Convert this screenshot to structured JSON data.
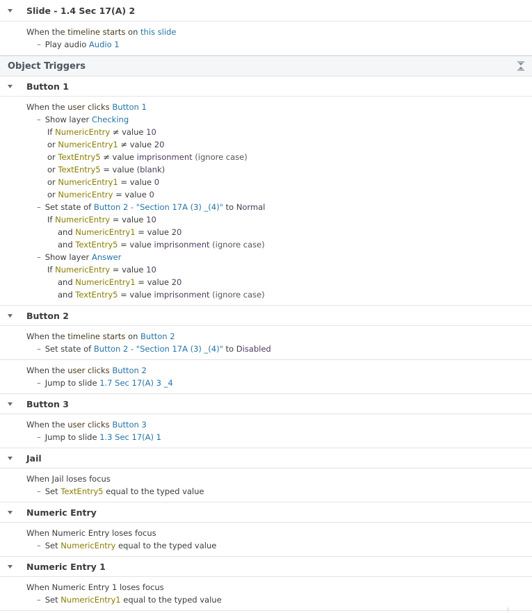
{
  "slide": {
    "title": "Slide - 1.4 Sec 17(A) 2",
    "when": [
      "When the ",
      "timeline starts",
      " on ",
      "this slide"
    ],
    "action": [
      "Play audio ",
      "Audio 1"
    ]
  },
  "object_triggers": {
    "title": "Object Triggers",
    "collapse_icon": "collapse-all-icon"
  },
  "button1": {
    "title": "Button 1",
    "when": [
      "When the ",
      "user clicks",
      " ",
      "Button 1"
    ],
    "show_checking": [
      "Show layer ",
      "Checking"
    ],
    "conds_checking": [
      {
        "pre": "If ",
        "var": "NumericEntry",
        "op": " ≠ value ",
        "val": "10",
        "tail": ""
      },
      {
        "pre": "or ",
        "var": "NumericEntry1",
        "op": " ≠ value ",
        "val": "20",
        "tail": ""
      },
      {
        "pre": "or ",
        "var": "TextEntry5",
        "op": " ≠ value ",
        "val": "imprisonment",
        "tail": " (ignore case)"
      },
      {
        "pre": "or ",
        "var": "TextEntry5",
        "op": " = value ",
        "val": "(blank)",
        "tail": ""
      },
      {
        "pre": "or ",
        "var": "NumericEntry1",
        "op": " = value ",
        "val": "0",
        "tail": ""
      },
      {
        "pre": "or ",
        "var": "NumericEntry",
        "op": " = value ",
        "val": "0",
        "tail": ""
      }
    ],
    "set_state": [
      "Set state of ",
      "Button 2 - \"Section 17A (3) _(4)\"",
      " to ",
      "Normal"
    ],
    "conds_state": [
      {
        "pre": "If ",
        "var": "NumericEntry",
        "op": " = value ",
        "val": "10",
        "tail": ""
      },
      {
        "pre": "and ",
        "var": "NumericEntry1",
        "op": " = value ",
        "val": "20",
        "tail": ""
      },
      {
        "pre": "and ",
        "var": "TextEntry5",
        "op": " = value ",
        "val": "imprisonment",
        "tail": " (ignore case)"
      }
    ],
    "show_answer": [
      "Show layer ",
      "Answer"
    ],
    "conds_answer": [
      {
        "pre": "If ",
        "var": "NumericEntry",
        "op": " = value ",
        "val": "10",
        "tail": ""
      },
      {
        "pre": "and ",
        "var": "NumericEntry1",
        "op": " = value ",
        "val": "20",
        "tail": ""
      },
      {
        "pre": "and ",
        "var": "TextEntry5",
        "op": " = value ",
        "val": "imprisonment",
        "tail": " (ignore case)"
      }
    ]
  },
  "button2": {
    "title": "Button 2",
    "t1_when": [
      "When the ",
      "timeline starts",
      " on ",
      "Button 2"
    ],
    "t1_action": [
      "Set state of ",
      "Button 2 - \"Section 17A (3) _(4)\"",
      " to ",
      "Disabled"
    ],
    "t2_when": [
      "When the ",
      "user clicks",
      " ",
      "Button 2"
    ],
    "t2_action": [
      "Jump to slide ",
      "1.7 Sec 17(A) 3 _4"
    ]
  },
  "button3": {
    "title": "Button 3",
    "when": [
      "When the ",
      "user clicks",
      " ",
      "Button 3"
    ],
    "action": [
      "Jump to slide ",
      "1.3 Sec 17(A) 1"
    ]
  },
  "jail": {
    "title": "Jail",
    "when": "When Jail loses focus",
    "action": [
      "Set ",
      "TextEntry5",
      " equal to the typed value"
    ]
  },
  "numeric_entry": {
    "title": "Numeric Entry",
    "when": "When Numeric Entry loses focus",
    "action": [
      "Set ",
      "NumericEntry",
      " equal to the typed value"
    ]
  },
  "numeric_entry1": {
    "title": "Numeric Entry 1",
    "when": "When Numeric Entry 1 loses focus",
    "action": [
      "Set ",
      "NumericEntry1",
      " equal to the typed value"
    ]
  },
  "colors": {
    "object": "#2474a6",
    "variable": "#8a7d00",
    "group_header_bg": "#f4f6f8"
  }
}
